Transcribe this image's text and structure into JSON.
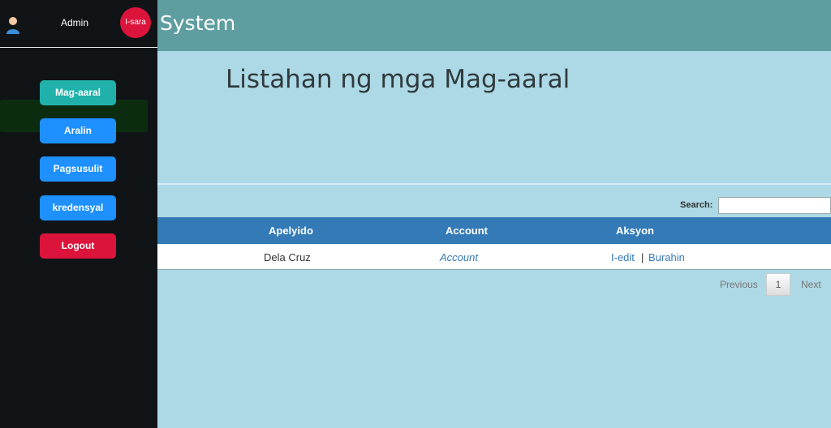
{
  "header": {
    "brand_badge": "I-sara",
    "title": "System",
    "admin_label": "Admin"
  },
  "sidebar": {
    "items": [
      {
        "label": "Mag-aaral",
        "color": "#20b2aa"
      },
      {
        "label": "Aralin",
        "color": "#1e90ff"
      },
      {
        "label": "Pagsusulit",
        "color": "#1e90ff"
      },
      {
        "label": "kredensyal",
        "color": "#1e90ff"
      },
      {
        "label": "Logout",
        "color": "#dc143c"
      }
    ]
  },
  "main": {
    "title": "Listahan ng mga Mag-aaral",
    "search": {
      "label": "Search:",
      "value": ""
    },
    "table": {
      "columns": [
        "Apelyido",
        "Account",
        "Aksyon"
      ],
      "rows": [
        {
          "apelyido": "Dela Cruz",
          "account": "Account",
          "edit": "I-edit",
          "separator": "|",
          "delete": "Burahin"
        }
      ]
    },
    "pagination": {
      "previous": "Previous",
      "page": "1",
      "next": "Next"
    }
  },
  "colors": {
    "header": "#5f9ea0",
    "background": "#add8e6",
    "sidebar": "#101417",
    "table_header": "#337ab7",
    "accent_red": "#dc143c"
  }
}
